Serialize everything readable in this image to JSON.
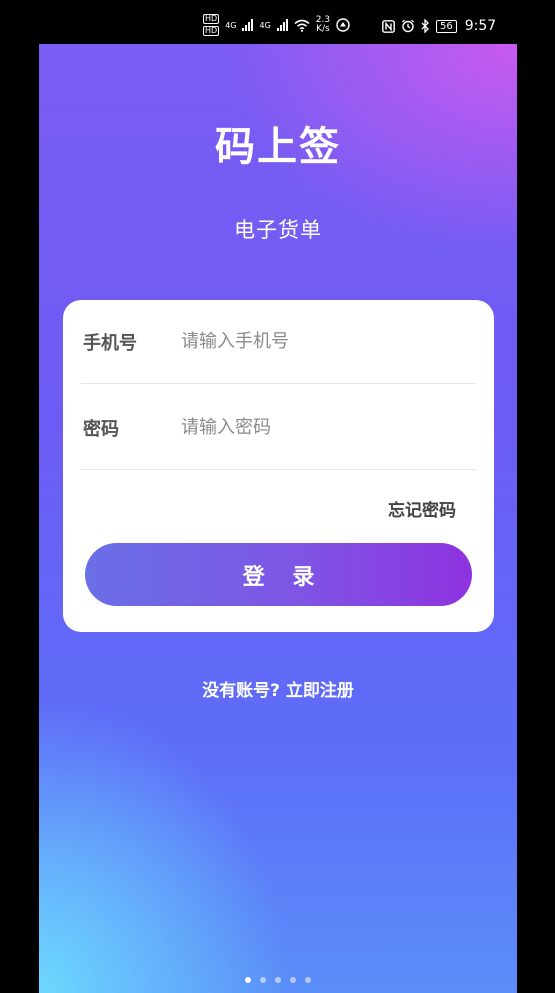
{
  "status_bar": {
    "hd1": "HD",
    "hd2": "HD",
    "net1": "4G",
    "net2": "4G",
    "speed_value": "2.3",
    "speed_unit": "K/s",
    "battery": "56",
    "time": "9:57"
  },
  "app": {
    "title": "码上签",
    "subtitle": "电子货单"
  },
  "form": {
    "phone_label": "手机号",
    "phone_placeholder": "请输入手机号",
    "password_label": "密码",
    "password_placeholder": "请输入密码",
    "forgot_label": "忘记密码",
    "login_label": "登 录"
  },
  "register": {
    "label": "没有账号? 立即注册"
  },
  "pager": {
    "count": 5,
    "active_index": 0
  },
  "colors": {
    "accent_start": "#6a6fe6",
    "accent_end": "#8e33df",
    "background_top": "#7b5cf2",
    "background_bottom": "#5a8ef8"
  }
}
